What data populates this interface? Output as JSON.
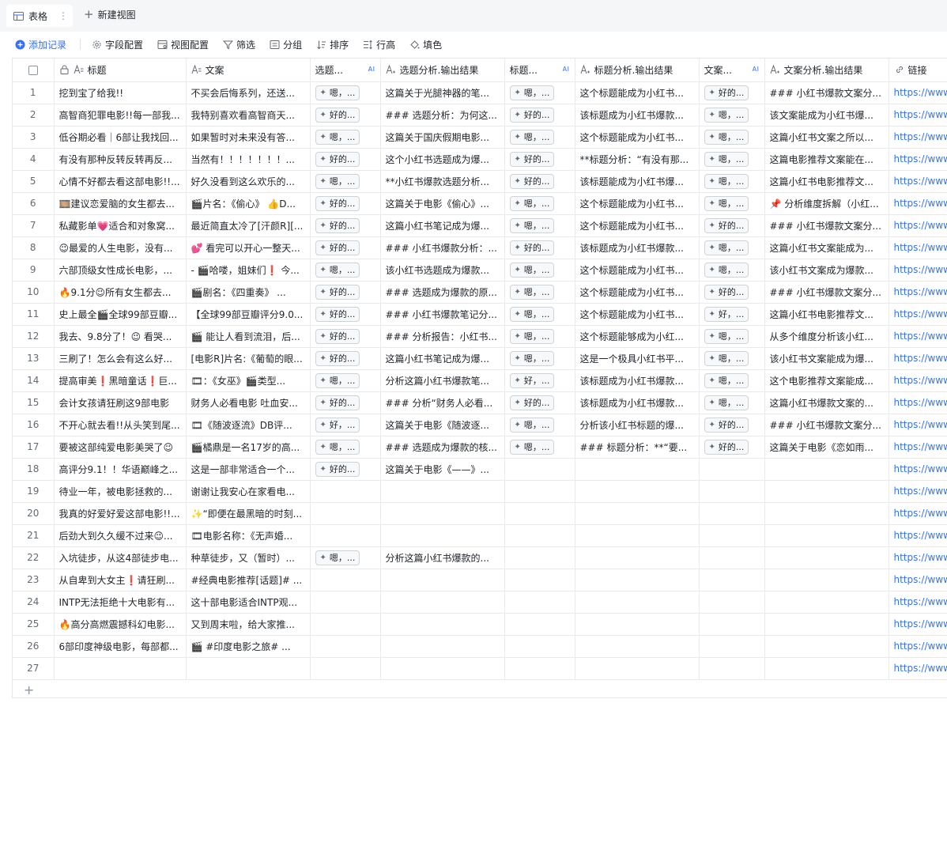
{
  "view_tabs": {
    "active_label": "表格",
    "more_glyph": "⋮",
    "new_view_label": "新建视图"
  },
  "toolbar": {
    "add_record": "添加记录",
    "field_config": "字段配置",
    "view_config": "视图配置",
    "filter": "筛选",
    "group": "分组",
    "sort": "排序",
    "row_height": "行高",
    "fill_color": "填色"
  },
  "columns": [
    {
      "key": "title",
      "label": "标题",
      "icon": "lock-text-icon"
    },
    {
      "key": "copy",
      "label": "文案",
      "icon": "text-icon"
    },
    {
      "key": "topic",
      "label": "选题...",
      "ai": "AI"
    },
    {
      "key": "topic_out",
      "label": "选题分析.输出结果",
      "icon": "ai-text-icon"
    },
    {
      "key": "title_ai",
      "label": "标题...",
      "ai": "AI"
    },
    {
      "key": "title_out",
      "label": "标题分析.输出结果",
      "icon": "ai-text-icon"
    },
    {
      "key": "copy_ai",
      "label": "文案...",
      "ai": "AI"
    },
    {
      "key": "copy_out",
      "label": "文案分析.输出结果",
      "icon": "ai-text-icon"
    },
    {
      "key": "link",
      "label": "链接",
      "icon": "link-icon"
    }
  ],
  "rows": [
    {
      "n": "1",
      "title": "挖到宝了给我!!",
      "copy": "不买会后悔系列，还送...",
      "topic": "嗯，...",
      "topic_out": "这篇关于光腿神器的笔...",
      "title_ai": "嗯，...",
      "title_out": "这个标题能成为小红书...",
      "copy_ai": "好的...",
      "copy_out": "### 小红书爆款文案分...",
      "link": "https://www"
    },
    {
      "n": "2",
      "title": "高智商犯罪电影!!每一部我...",
      "copy": "我特别喜欢看高智商天...",
      "topic": "好的...",
      "topic_out": "### 选题分析：为何这...",
      "title_ai": "好的...",
      "title_out": "该标题成为小红书爆款...",
      "copy_ai": "嗯，...",
      "copy_out": "该文案能成为小红书爆...",
      "link": "https://www"
    },
    {
      "n": "3",
      "title": "低谷期必看｜6部让我找回...",
      "copy": "如果暂时对未来没有答...",
      "topic": "嗯，...",
      "topic_out": "这篇关于国庆假期电影...",
      "title_ai": "嗯，...",
      "title_out": "这个标题能成为小红书...",
      "copy_ai": "嗯，...",
      "copy_out": "这篇小红书文案之所以...",
      "link": "https://www"
    },
    {
      "n": "4",
      "title": "有没有那种反转反转再反...",
      "copy": "当然有！！！！！！！...",
      "topic": "好的...",
      "topic_out": "这个小红书选题成为爆...",
      "title_ai": "好的...",
      "title_out": "**标题分析：“有没有那...",
      "copy_ai": "嗯，...",
      "copy_out": "这篇电影推荐文案能在...",
      "link": "https://www"
    },
    {
      "n": "5",
      "title": "心情不好都去看这部电影!!...",
      "copy": "好久没看到这么欢乐的...",
      "topic": "嗯，...",
      "topic_out": "**小红书爆款选题分析...",
      "title_ai": "好的...",
      "title_out": "该标题能成为小红书爆...",
      "copy_ai": "嗯，...",
      "copy_out": "这篇小红书电影推荐文...",
      "link": "https://www"
    },
    {
      "n": "6",
      "title": "🎞️建议恋爱脑的女生都去...",
      "copy": "🎬片名：《偷心》 👍D...",
      "topic": "好的...",
      "topic_out": "这篇关于电影《偷心》...",
      "title_ai": "嗯，...",
      "title_out": "这个标题能成为小红书...",
      "copy_ai": "嗯，...",
      "copy_out": "📌 分析维度拆解（小红...",
      "link": "https://www"
    },
    {
      "n": "7",
      "title": "私藏影单💗适合和对象窝...",
      "copy": "最近简直太冷了[汗颜R][...",
      "topic": "好的...",
      "topic_out": "这篇小红书笔记成为爆...",
      "title_ai": "嗯，...",
      "title_out": "这个标题能成为小红书...",
      "copy_ai": "好的...",
      "copy_out": "### 小红书爆款文案分...",
      "link": "https://www"
    },
    {
      "n": "8",
      "title": "😉最爱的人生电影，没有...",
      "copy": "💕 看完可以开心一整天...",
      "topic": "好的...",
      "topic_out": "### 小红书爆款分析：...",
      "title_ai": "好的...",
      "title_out": "该标题成为小红书爆款...",
      "copy_ai": "嗯，...",
      "copy_out": "这篇小红书文案能成为...",
      "link": "https://www"
    },
    {
      "n": "9",
      "title": "六部顶级女性成长电影，...",
      "copy": "- 🎬哈喽，姐妹们❗ 今...",
      "topic": "嗯，...",
      "topic_out": "该小红书选题成为爆款...",
      "title_ai": "嗯，...",
      "title_out": "这个标题能成为小红书...",
      "copy_ai": "嗯，...",
      "copy_out": "该小红书文案成为爆款...",
      "link": "https://www"
    },
    {
      "n": "10",
      "title": "🔥9.1分😉所有女生都去...",
      "copy": "🎬剧名：《四重奏》 ...",
      "topic": "好的...",
      "topic_out": "### 选题成为爆款的原...",
      "title_ai": "嗯，...",
      "title_out": "这个标题能成为小红书...",
      "copy_ai": "好的...",
      "copy_out": "### 小红书爆款文案分...",
      "link": "https://www"
    },
    {
      "n": "11",
      "title": "史上最全🎬全球99部豆瓣...",
      "copy": "【全球99部豆瓣评分9.0...",
      "topic": "好的...",
      "topic_out": "### 小红书爆款笔记分...",
      "title_ai": "嗯，...",
      "title_out": "这个标题能成为小红书...",
      "copy_ai": "好，...",
      "copy_out": "这篇小红书电影推荐文...",
      "link": "https://www"
    },
    {
      "n": "12",
      "title": "我去、9.8分了！😉 看哭...",
      "copy": "🎬 能让人看到流泪，后...",
      "topic": "好的...",
      "topic_out": "### 分析报告：小红书...",
      "title_ai": "嗯，...",
      "title_out": "这个标题能够成为小红...",
      "copy_ai": "嗯，...",
      "copy_out": "从多个维度分析该小红...",
      "link": "https://www"
    },
    {
      "n": "13",
      "title": "三刷了！怎么会有这么好...",
      "copy": "[电影R]片名:《葡萄的眼...",
      "topic": "好的...",
      "topic_out": "这篇小红书笔记成为爆...",
      "title_ai": "嗯，...",
      "title_out": "这是一个极具小红书平...",
      "copy_ai": "嗯，...",
      "copy_out": "该小红书文案能成为爆...",
      "link": "https://www"
    },
    {
      "n": "14",
      "title": "提高审美❗黑暗童话❗巨...",
      "copy": "🎞：《女巫》🎬类型...",
      "topic": "嗯，...",
      "topic_out": "分析这篇小红书爆款笔...",
      "title_ai": "好，...",
      "title_out": "该标题成为小红书爆款...",
      "copy_ai": "嗯，...",
      "copy_out": "这个电影推荐文案能成...",
      "link": "https://www"
    },
    {
      "n": "15",
      "title": "会计女孩请狂刷这9部电影",
      "copy": "财务人必看电影 吐血安...",
      "topic": "好的...",
      "topic_out": "### 分析“财务人必看...",
      "title_ai": "好的...",
      "title_out": "该标题成为小红书爆款...",
      "copy_ai": "嗯，...",
      "copy_out": "这篇小红书爆款文案的...",
      "link": "https://www"
    },
    {
      "n": "16",
      "title": "不开心就去看!!从头笑到尾...",
      "copy": "🎞《随波逐流》DB评...",
      "topic": "好，...",
      "topic_out": "这篇关于电影《随波逐...",
      "title_ai": "嗯，...",
      "title_out": "分析该小红书标题的爆...",
      "copy_ai": "好的...",
      "copy_out": "### 小红书爆款文案分...",
      "link": "https://www"
    },
    {
      "n": "17",
      "title": "要被这部纯爱电影美哭了😉",
      "copy": "🎬橘鼎是一名17岁的高...",
      "topic": "嗯，...",
      "topic_out": "### 选题成为爆款的核...",
      "title_ai": "嗯，...",
      "title_out": "### 标题分析：**“要...",
      "copy_ai": "好的...",
      "copy_out": "这篇关于电影《恋如雨...",
      "link": "https://www"
    },
    {
      "n": "18",
      "title": "高评分9.1！！华语巅峰之...",
      "copy": "这是一部非常适合一个...",
      "topic": "好的...",
      "topic_out": "这篇关于电影《——》...",
      "title_ai": "",
      "title_out": "",
      "copy_ai": "",
      "copy_out": "",
      "link": "https://www"
    },
    {
      "n": "19",
      "title": "待业一年，被电影拯救的...",
      "copy": "谢谢让我安心在家看电...",
      "topic": "",
      "topic_out": "",
      "title_ai": "",
      "title_out": "",
      "copy_ai": "",
      "copy_out": "",
      "link": "https://www"
    },
    {
      "n": "20",
      "title": "我真的好爱好爱这部电影!!...",
      "copy": "✨“即便在最黑暗的时刻...",
      "topic": "",
      "topic_out": "",
      "title_ai": "",
      "title_out": "",
      "copy_ai": "",
      "copy_out": "",
      "link": "https://www"
    },
    {
      "n": "21",
      "title": "后劲大到久久缓不过来😉...",
      "copy": "🎞电影名称：《无声婚...",
      "topic": "",
      "topic_out": "",
      "title_ai": "",
      "title_out": "",
      "copy_ai": "",
      "copy_out": "",
      "link": "https://www"
    },
    {
      "n": "22",
      "title": "入坑徒步，从这4部徒步电...",
      "copy": "种草徒步，又（暂时）...",
      "topic": "嗯，...",
      "topic_out": "分析这篇小红书爆款的...",
      "title_ai": "",
      "title_out": "",
      "copy_ai": "",
      "copy_out": "",
      "link": "https://www"
    },
    {
      "n": "23",
      "title": "从自卑到大女主❗请狂刷...",
      "copy": "#经典电影推荐[话题]# ...",
      "topic": "",
      "topic_out": "",
      "title_ai": "",
      "title_out": "",
      "copy_ai": "",
      "copy_out": "",
      "link": "https://www"
    },
    {
      "n": "24",
      "title": "INTP无法拒绝十大电影有...",
      "copy": "这十部电影适合INTP观...",
      "topic": "",
      "topic_out": "",
      "title_ai": "",
      "title_out": "",
      "copy_ai": "",
      "copy_out": "",
      "link": "https://www"
    },
    {
      "n": "25",
      "title": "🔥高分高燃震撼科幻电影...",
      "copy": "又到周末啦，给大家推...",
      "topic": "",
      "topic_out": "",
      "title_ai": "",
      "title_out": "",
      "copy_ai": "",
      "copy_out": "",
      "link": "https://www"
    },
    {
      "n": "26",
      "title": "6部印度神级电影，每部都...",
      "copy": "🎬 #印度电影之旅# ...",
      "topic": "",
      "topic_out": "",
      "title_ai": "",
      "title_out": "",
      "copy_ai": "",
      "copy_out": "",
      "link": "https://www"
    },
    {
      "n": "27",
      "title": "",
      "copy": "",
      "topic": "",
      "topic_out": "",
      "title_ai": "",
      "title_out": "",
      "copy_ai": "",
      "copy_out": "",
      "link": "https://www"
    }
  ],
  "colors": {
    "accent": "#3370ff",
    "border": "#e8eaed",
    "tab_bar": "#f5f6f7"
  }
}
